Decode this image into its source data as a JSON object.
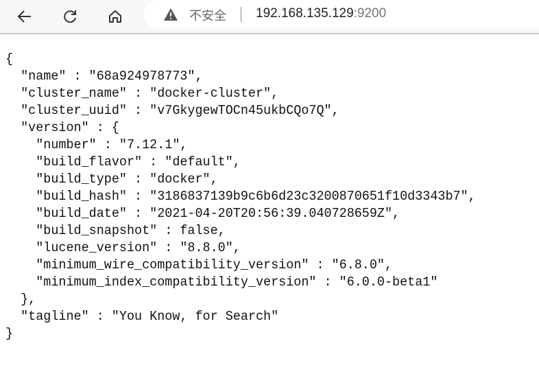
{
  "browser": {
    "security_label": "不安全",
    "url_host": "192.168.135.129",
    "url_port": ":9200",
    "icons": [
      "back-arrow-icon",
      "reload-icon",
      "home-icon",
      "warning-triangle-icon"
    ]
  },
  "response_lines": [
    "{",
    "  \"name\" : \"68a924978773\",",
    "  \"cluster_name\" : \"docker-cluster\",",
    "  \"cluster_uuid\" : \"v7GkygewTOCn45ukbCQo7Q\",",
    "  \"version\" : {",
    "    \"number\" : \"7.12.1\",",
    "    \"build_flavor\" : \"default\",",
    "    \"build_type\" : \"docker\",",
    "    \"build_hash\" : \"3186837139b9c6b6d23c3200870651f10d3343b7\",",
    "    \"build_date\" : \"2021-04-20T20:56:39.040728659Z\",",
    "    \"build_snapshot\" : false,",
    "    \"lucene_version\" : \"8.8.0\",",
    "    \"minimum_wire_compatibility_version\" : \"6.8.0\",",
    "    \"minimum_index_compatibility_version\" : \"6.0.0-beta1\"",
    "  },",
    "  \"tagline\" : \"You Know, for Search\"",
    "}"
  ]
}
